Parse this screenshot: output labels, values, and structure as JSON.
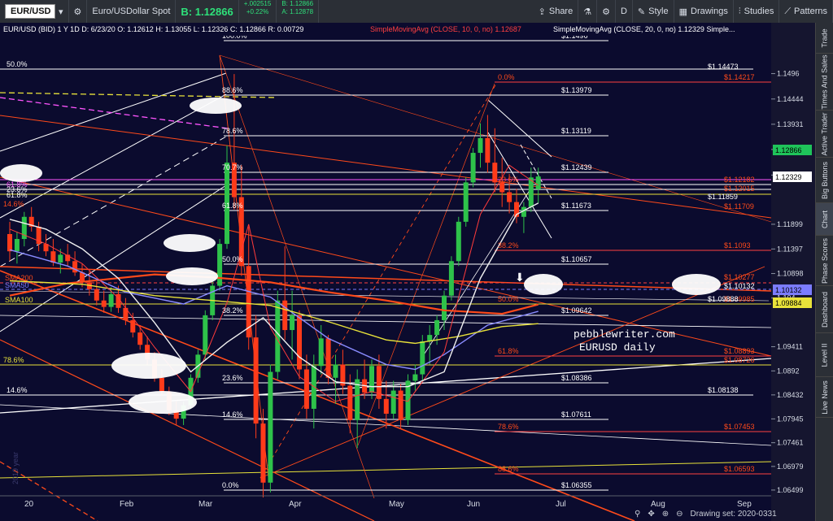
{
  "topbar": {
    "symbol": "EUR/USD",
    "description": "Euro/USDollar Spot",
    "bid_price": "B: 1.12866",
    "change": "+.002515",
    "change_pct": "+0.22%",
    "bid_small": "B: 1.12866",
    "ask_small": "A: 1.12878",
    "share": "Share",
    "period": "D",
    "style": "Style",
    "drawings": "Drawings",
    "studies": "Studies",
    "patterns": "Patterns"
  },
  "header": {
    "line1": "EUR/USD (BID) 1 Y 1D   D: 6/23/20   O: 1.12612   H: 1.13055   L: 1.12326   C: 1.12866   R: 0.00729",
    "sma10": "SimpleMovingAvg (CLOSE, 10, 0, no)   1.12687",
    "sma20": "SimpleMovingAvg (CLOSE, 20, 0, no)   1.12329   Simple..."
  },
  "sidebar": [
    "Trade",
    "Times And Sales",
    "Active Trader",
    "Big Buttons",
    "Chart",
    "Phase Scores",
    "Dashboard",
    "Level II",
    "Live News"
  ],
  "bottom": {
    "drawing_set": "Drawing set: 2020-0331"
  },
  "watermark": {
    "site": "pebblewriter.com",
    "subtitle": "EURUSD daily"
  },
  "chart_data": {
    "type": "candlestick",
    "instrument": "EUR/USD",
    "timeframe": "1 Y 1D",
    "x_labels": [
      "20",
      "Feb",
      "Mar",
      "Apr",
      "May",
      "Jun",
      "Jul",
      "Aug",
      "Sep"
    ],
    "y_ticks": [
      "1.1496",
      "1.14444",
      "1.13931",
      "1.13419",
      "1.12899",
      "1.11899",
      "1.11397",
      "1.10898",
      "1.104",
      "1.09411",
      "1.0892",
      "1.08432",
      "1.07945",
      "1.07461",
      "1.06979",
      "1.06499"
    ],
    "ylim": [
      1.0625,
      1.1525
    ],
    "candles": [
      {
        "d": 0,
        "o": 1.117,
        "h": 1.1195,
        "l": 1.1115,
        "c": 1.1135
      },
      {
        "d": 1,
        "o": 1.1135,
        "h": 1.1175,
        "l": 1.111,
        "c": 1.116
      },
      {
        "d": 2,
        "o": 1.116,
        "h": 1.1215,
        "l": 1.1145,
        "c": 1.1205
      },
      {
        "d": 3,
        "o": 1.1205,
        "h": 1.1225,
        "l": 1.1175,
        "c": 1.1185
      },
      {
        "d": 4,
        "o": 1.1185,
        "h": 1.1195,
        "l": 1.1135,
        "c": 1.115
      },
      {
        "d": 5,
        "o": 1.115,
        "h": 1.117,
        "l": 1.1125,
        "c": 1.1135
      },
      {
        "d": 6,
        "o": 1.1135,
        "h": 1.116,
        "l": 1.1105,
        "c": 1.1112
      },
      {
        "d": 7,
        "o": 1.1112,
        "h": 1.114,
        "l": 1.109,
        "c": 1.1128
      },
      {
        "d": 8,
        "o": 1.1128,
        "h": 1.115,
        "l": 1.1105,
        "c": 1.1115
      },
      {
        "d": 9,
        "o": 1.1115,
        "h": 1.1135,
        "l": 1.1085,
        "c": 1.1092
      },
      {
        "d": 10,
        "o": 1.1092,
        "h": 1.111,
        "l": 1.1062,
        "c": 1.1072
      },
      {
        "d": 11,
        "o": 1.1072,
        "h": 1.1095,
        "l": 1.1045,
        "c": 1.1058
      },
      {
        "d": 12,
        "o": 1.1058,
        "h": 1.108,
        "l": 1.1025,
        "c": 1.1035
      },
      {
        "d": 13,
        "o": 1.1035,
        "h": 1.1055,
        "l": 1.101,
        "c": 1.1022
      },
      {
        "d": 14,
        "o": 1.1022,
        "h": 1.1062,
        "l": 1.1012,
        "c": 1.1048
      },
      {
        "d": 15,
        "o": 1.1048,
        "h": 1.1065,
        "l": 1.101,
        "c": 1.102
      },
      {
        "d": 16,
        "o": 1.102,
        "h": 1.104,
        "l": 1.0985,
        "c": 1.0995
      },
      {
        "d": 17,
        "o": 1.0995,
        "h": 1.101,
        "l": 1.096,
        "c": 1.097
      },
      {
        "d": 18,
        "o": 1.097,
        "h": 1.0985,
        "l": 1.0935,
        "c": 1.0945
      },
      {
        "d": 19,
        "o": 1.0945,
        "h": 1.0962,
        "l": 1.0905,
        "c": 1.0915
      },
      {
        "d": 20,
        "o": 1.0915,
        "h": 1.093,
        "l": 1.087,
        "c": 1.0878
      },
      {
        "d": 21,
        "o": 1.0878,
        "h": 1.0895,
        "l": 1.0842,
        "c": 1.085
      },
      {
        "d": 22,
        "o": 1.085,
        "h": 1.086,
        "l": 1.0802,
        "c": 1.0812
      },
      {
        "d": 23,
        "o": 1.0812,
        "h": 1.083,
        "l": 1.0782,
        "c": 1.0795
      },
      {
        "d": 24,
        "o": 1.0795,
        "h": 1.083,
        "l": 1.0782,
        "c": 1.0822
      },
      {
        "d": 25,
        "o": 1.0822,
        "h": 1.0885,
        "l": 1.0815,
        "c": 1.0878
      },
      {
        "d": 26,
        "o": 1.0878,
        "h": 1.0935,
        "l": 1.0868,
        "c": 1.0925
      },
      {
        "d": 27,
        "o": 1.0925,
        "h": 1.1015,
        "l": 1.0915,
        "c": 1.1005
      },
      {
        "d": 28,
        "o": 1.1005,
        "h": 1.1075,
        "l": 1.0995,
        "c": 1.1065
      },
      {
        "d": 29,
        "o": 1.1065,
        "h": 1.116,
        "l": 1.1055,
        "c": 1.115
      },
      {
        "d": 30,
        "o": 1.115,
        "h": 1.135,
        "l": 1.114,
        "c": 1.1315
      },
      {
        "d": 31,
        "o": 1.1315,
        "h": 1.1495,
        "l": 1.122,
        "c": 1.1245
      },
      {
        "d": 32,
        "o": 1.1245,
        "h": 1.131,
        "l": 1.1085,
        "c": 1.1105
      },
      {
        "d": 33,
        "o": 1.1105,
        "h": 1.1185,
        "l": 1.0935,
        "c": 1.096
      },
      {
        "d": 34,
        "o": 1.096,
        "h": 1.1005,
        "l": 1.0755,
        "c": 1.0785
      },
      {
        "d": 35,
        "o": 1.0785,
        "h": 1.0815,
        "l": 1.0635,
        "c": 1.0665
      },
      {
        "d": 36,
        "o": 1.0665,
        "h": 1.0905,
        "l": 1.0645,
        "c": 1.089
      },
      {
        "d": 37,
        "o": 1.089,
        "h": 1.1055,
        "l": 1.0875,
        "c": 1.1035
      },
      {
        "d": 38,
        "o": 1.1035,
        "h": 1.1145,
        "l": 1.0955,
        "c": 1.0975
      },
      {
        "d": 39,
        "o": 1.0975,
        "h": 1.1055,
        "l": 1.0915,
        "c": 1.1005
      },
      {
        "d": 40,
        "o": 1.1005,
        "h": 1.1015,
        "l": 1.0875,
        "c": 1.0895
      },
      {
        "d": 41,
        "o": 1.0895,
        "h": 1.0925,
        "l": 1.0795,
        "c": 1.0815
      },
      {
        "d": 42,
        "o": 1.0815,
        "h": 1.0925,
        "l": 1.0775,
        "c": 1.0902
      },
      {
        "d": 43,
        "o": 1.0902,
        "h": 1.0985,
        "l": 1.0885,
        "c": 1.0958
      },
      {
        "d": 44,
        "o": 1.0958,
        "h": 1.0965,
        "l": 1.0865,
        "c": 1.0878
      },
      {
        "d": 45,
        "o": 1.0878,
        "h": 1.0925,
        "l": 1.0825,
        "c": 1.0905
      },
      {
        "d": 46,
        "o": 1.0905,
        "h": 1.0935,
        "l": 1.0845,
        "c": 1.0862
      },
      {
        "d": 47,
        "o": 1.0862,
        "h": 1.0885,
        "l": 1.0765,
        "c": 1.0792
      },
      {
        "d": 48,
        "o": 1.0792,
        "h": 1.0895,
        "l": 1.0735,
        "c": 1.0875
      },
      {
        "d": 49,
        "o": 1.0875,
        "h": 1.0915,
        "l": 1.0835,
        "c": 1.0848
      },
      {
        "d": 50,
        "o": 1.0848,
        "h": 1.0915,
        "l": 1.0835,
        "c": 1.0902
      },
      {
        "d": 51,
        "o": 1.0902,
        "h": 1.0925,
        "l": 1.0815,
        "c": 1.0835
      },
      {
        "d": 52,
        "o": 1.0835,
        "h": 1.0872,
        "l": 1.0775,
        "c": 1.0805
      },
      {
        "d": 53,
        "o": 1.0805,
        "h": 1.0872,
        "l": 1.0795,
        "c": 1.0852
      },
      {
        "d": 54,
        "o": 1.0852,
        "h": 1.0865,
        "l": 1.0775,
        "c": 1.0792
      },
      {
        "d": 55,
        "o": 1.0792,
        "h": 1.0885,
        "l": 1.0782,
        "c": 1.0872
      },
      {
        "d": 56,
        "o": 1.0872,
        "h": 1.0905,
        "l": 1.0852,
        "c": 1.0885
      },
      {
        "d": 57,
        "o": 1.0885,
        "h": 1.0965,
        "l": 1.0872,
        "c": 1.0952
      },
      {
        "d": 58,
        "o": 1.0952,
        "h": 1.0985,
        "l": 1.0905,
        "c": 1.0965
      },
      {
        "d": 59,
        "o": 1.0965,
        "h": 1.1005,
        "l": 1.0945,
        "c": 1.0995
      },
      {
        "d": 60,
        "o": 1.0995,
        "h": 1.1055,
        "l": 1.0975,
        "c": 1.1045
      },
      {
        "d": 61,
        "o": 1.1045,
        "h": 1.1125,
        "l": 1.1035,
        "c": 1.1115
      },
      {
        "d": 62,
        "o": 1.1115,
        "h": 1.1205,
        "l": 1.1105,
        "c": 1.1195
      },
      {
        "d": 63,
        "o": 1.1195,
        "h": 1.1285,
        "l": 1.1185,
        "c": 1.1275
      },
      {
        "d": 64,
        "o": 1.1275,
        "h": 1.1345,
        "l": 1.1265,
        "c": 1.1335
      },
      {
        "d": 65,
        "o": 1.1335,
        "h": 1.1395,
        "l": 1.1305,
        "c": 1.1365
      },
      {
        "d": 66,
        "o": 1.1365,
        "h": 1.1412,
        "l": 1.1295,
        "c": 1.1315
      },
      {
        "d": 67,
        "o": 1.1315,
        "h": 1.1385,
        "l": 1.1255,
        "c": 1.1275
      },
      {
        "d": 68,
        "o": 1.1275,
        "h": 1.1325,
        "l": 1.1225,
        "c": 1.1255
      },
      {
        "d": 69,
        "o": 1.1255,
        "h": 1.1292,
        "l": 1.1212,
        "c": 1.1235
      },
      {
        "d": 70,
        "o": 1.1235,
        "h": 1.1262,
        "l": 1.1192,
        "c": 1.1205
      },
      {
        "d": 71,
        "o": 1.1205,
        "h": 1.1235,
        "l": 1.1172,
        "c": 1.1225
      },
      {
        "d": 72,
        "o": 1.1225,
        "h": 1.1305,
        "l": 1.1215,
        "c": 1.1285
      },
      {
        "d": 73,
        "o": 1.1261,
        "h": 1.1305,
        "l": 1.1233,
        "c": 1.1287
      }
    ],
    "series": [
      {
        "name": "SMA200",
        "color": "#ff4a1a",
        "values": [
          [
            0,
            1.1045
          ],
          [
            8,
            1.107
          ],
          [
            20,
            1.1088
          ],
          [
            28,
            1.1082
          ],
          [
            36,
            1.1072
          ],
          [
            44,
            1.1052
          ],
          [
            52,
            1.1035
          ],
          [
            60,
            1.1015
          ],
          [
            68,
            1.1008
          ],
          [
            73,
            1.1027
          ]
        ]
      },
      {
        "name": "SMA50",
        "color": "#8a8cff",
        "values": [
          [
            0,
            1.1138
          ],
          [
            8,
            1.1105
          ],
          [
            16,
            1.1052
          ],
          [
            24,
            1.1028
          ],
          [
            30,
            1.1065
          ],
          [
            36,
            1.1042
          ],
          [
            44,
            1.0958
          ],
          [
            52,
            1.0905
          ],
          [
            56,
            1.0895
          ],
          [
            60,
            1.0925
          ],
          [
            66,
            1.0985
          ],
          [
            73,
            1.1013
          ]
        ]
      },
      {
        "name": "SMA100",
        "color": "#e8e23a",
        "values": [
          [
            0,
            1.1075
          ],
          [
            10,
            1.1068
          ],
          [
            20,
            1.1045
          ],
          [
            28,
            1.1035
          ],
          [
            36,
            1.1025
          ],
          [
            44,
            1.0992
          ],
          [
            52,
            1.0955
          ],
          [
            56,
            1.0948
          ],
          [
            62,
            1.0962
          ],
          [
            68,
            1.0982
          ],
          [
            73,
            1.0988
          ]
        ]
      },
      {
        "name": "SMA10",
        "color": "#ff3b3b",
        "values": [
          [
            0,
            1.118
          ],
          [
            5,
            1.115
          ],
          [
            10,
            1.111
          ],
          [
            15,
            1.104
          ],
          [
            20,
            1.094
          ],
          [
            25,
            1.085
          ],
          [
            30,
            1.103
          ],
          [
            33,
            1.119
          ],
          [
            36,
            1.098
          ],
          [
            40,
            1.088
          ],
          [
            45,
            1.083
          ],
          [
            50,
            1.085
          ],
          [
            55,
            1.083
          ],
          [
            60,
            1.093
          ],
          [
            65,
            1.121
          ],
          [
            69,
            1.131
          ],
          [
            73,
            1.1269
          ]
        ]
      },
      {
        "name": "SMA20",
        "color": "#f0f0f0",
        "values": [
          [
            0,
            1.12
          ],
          [
            5,
            1.118
          ],
          [
            10,
            1.114
          ],
          [
            15,
            1.108
          ],
          [
            20,
            1.099
          ],
          [
            25,
            1.089
          ],
          [
            30,
            1.095
          ],
          [
            35,
            1.1
          ],
          [
            40,
            1.092
          ],
          [
            45,
            1.087
          ],
          [
            50,
            1.086
          ],
          [
            55,
            1.086
          ],
          [
            60,
            1.089
          ],
          [
            65,
            1.108
          ],
          [
            70,
            1.121
          ],
          [
            73,
            1.1233
          ]
        ]
      }
    ],
    "fib_left": {
      "levels": [
        "100.0%",
        "88.6%",
        "78.6%",
        "70.7%",
        "61.8%",
        "50.0%",
        "38.2%",
        "23.6%",
        "14.6%",
        "0.0%"
      ],
      "prices": [
        "$1.1496",
        "$1.13979",
        "$1.13119",
        "$1.12439",
        "$1.11673",
        "$1.10657",
        "$1.09642",
        "$1.08386",
        "$1.07611",
        "$1.06355"
      ]
    },
    "fib_right": {
      "levels": [
        "0.0%",
        "23.6%",
        "38.2%",
        "50.0%",
        "61.8%",
        "78.6%",
        "88.6%"
      ],
      "prices": [
        "$1.14217",
        "$1.12182",
        "$1.1093",
        "$1.09985",
        "$1.08893",
        "$1.07453",
        "$1.06593"
      ]
    },
    "side_prices": [
      "$1.14473",
      "$1.12015",
      "$1.11859",
      "$1.11709",
      "$1.10277",
      "$1.10132",
      "$1.09888",
      "$1.08726",
      "$1.08138"
    ],
    "price_badges": [
      {
        "label": "1.12866",
        "color": "#1fc45a"
      },
      {
        "label": "1.12329",
        "color": "#ffffff"
      },
      {
        "label": "1.10132",
        "color": "#7b7cff"
      },
      {
        "label": "1.09884",
        "color": "#e8e23a"
      }
    ],
    "ma_labels": [
      "SMA200",
      "SMA50",
      "SMA100"
    ],
    "left_pct_labels": [
      "50.0%",
      "61.8%",
      "23.6%",
      "61.8%",
      "14.6%",
      "78.6%",
      "14.6%"
    ],
    "year_label": "2019 year"
  }
}
